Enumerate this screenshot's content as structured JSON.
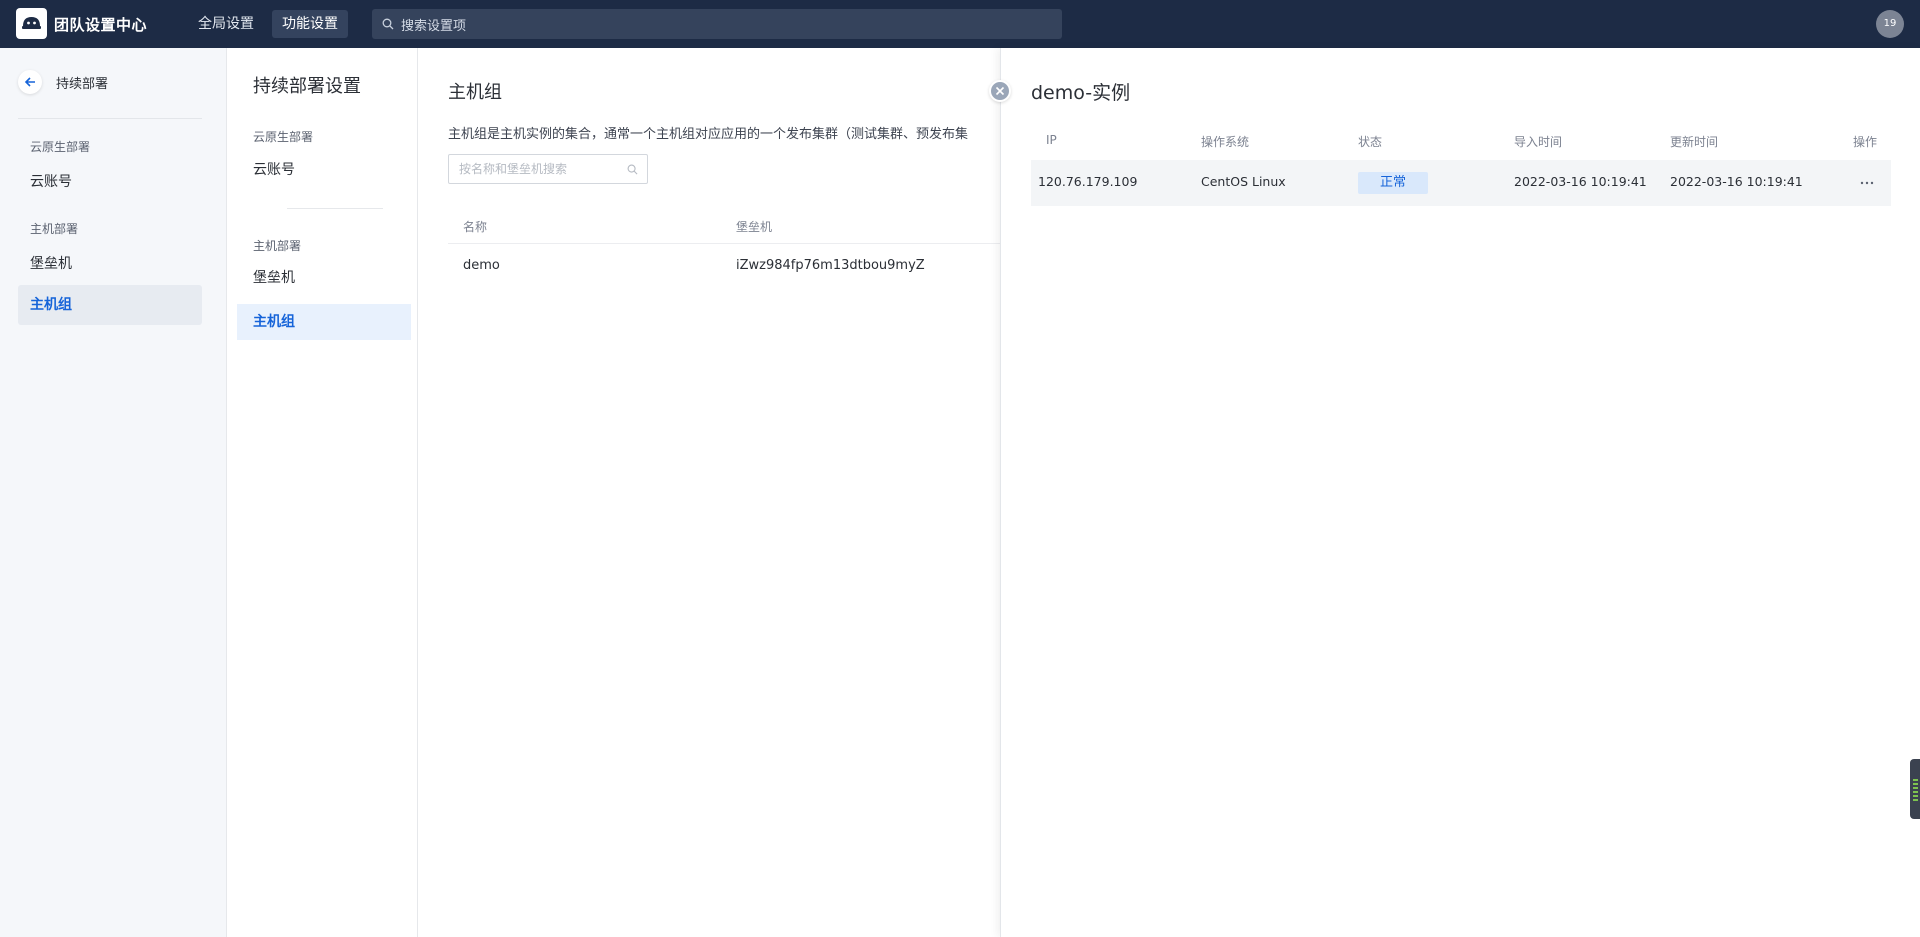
{
  "app": {
    "title": "团队设置中心",
    "avatar_text": "19"
  },
  "topnav": {
    "tabs": [
      "全局设置",
      "功能设置"
    ],
    "active_tab": 1,
    "search_placeholder": "搜索设置项"
  },
  "sidebar": {
    "back_label": "持续部署",
    "groups": [
      {
        "label": "云原生部署",
        "items": [
          "云账号"
        ]
      },
      {
        "label": "主机部署",
        "items": [
          "堡垒机",
          "主机组"
        ]
      }
    ],
    "active_item": "主机组"
  },
  "settings_panel": {
    "title": "持续部署设置",
    "groups": [
      {
        "label": "云原生部署",
        "items": [
          "云账号"
        ]
      },
      {
        "label": "主机部署",
        "items": [
          "堡垒机",
          "主机组"
        ]
      }
    ],
    "active_item": "主机组"
  },
  "main": {
    "title": "主机组",
    "description": "主机组是主机实例的集合，通常一个主机组对应应用的一个发布集群（测试集群、预发布集",
    "search_placeholder": "按名称和堡垒机搜索",
    "columns": [
      "名称",
      "堡垒机"
    ],
    "rows": [
      {
        "name": "demo",
        "bastion": "iZwz984fp76m13dtbou9myZ"
      }
    ]
  },
  "drawer": {
    "title": "demo-实例",
    "columns": [
      "IP",
      "操作系统",
      "状态",
      "导入时间",
      "更新时间",
      "操作"
    ],
    "rows": [
      {
        "ip": "120.76.179.109",
        "os": "CentOS Linux",
        "status": "正常",
        "imported": "2022-03-16 10:19:41",
        "updated": "2022-03-16 10:19:41"
      }
    ]
  },
  "colors": {
    "topbar": "#1d2b45",
    "accent": "#1664d9",
    "status_bg": "#d9e8fb"
  }
}
